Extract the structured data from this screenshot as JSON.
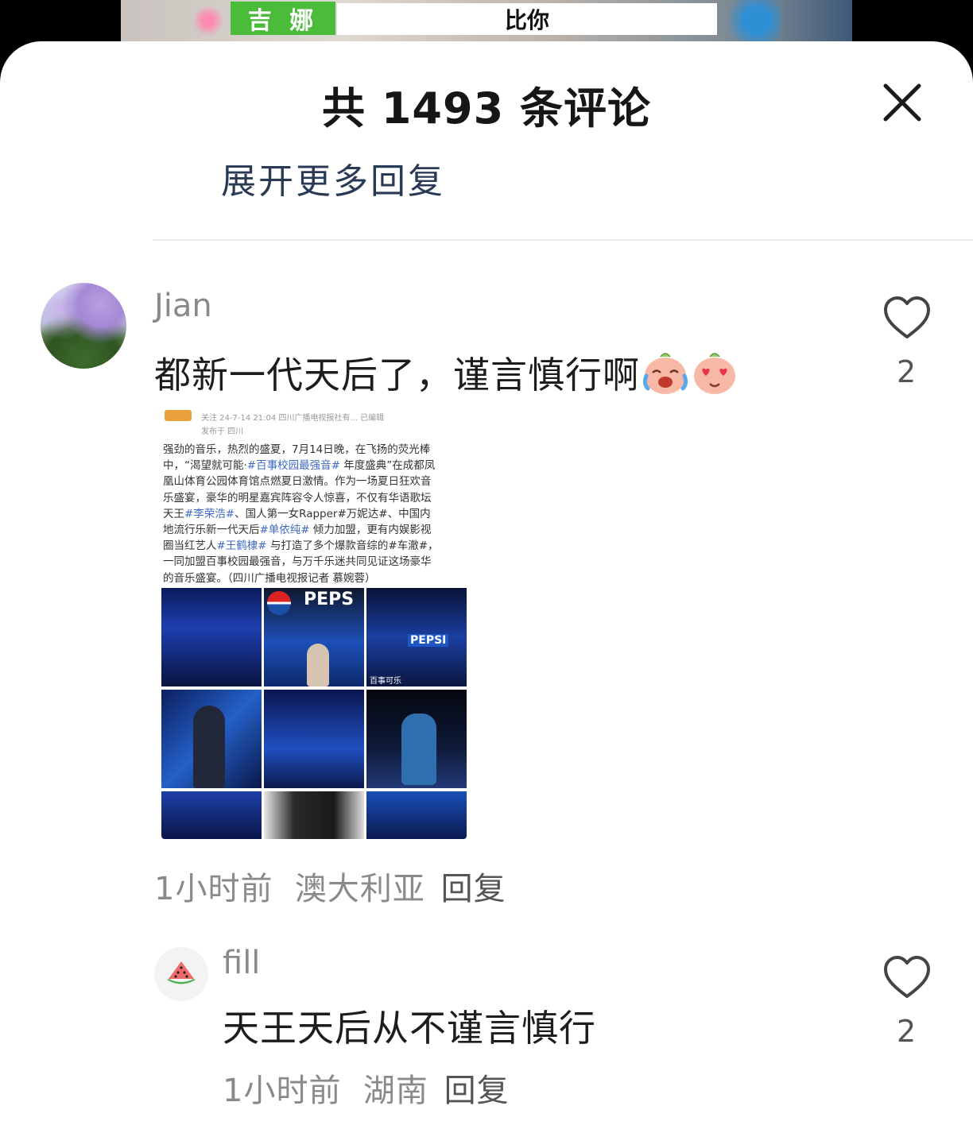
{
  "video": {
    "name_tag": "吉 娜",
    "lyric": "比你"
  },
  "panel": {
    "title": "共 1493 条评论",
    "expand_more": "展开更多回复"
  },
  "comment": {
    "username": "Jian",
    "text": "都新一代天后了，谨言慎行啊",
    "like_count": "2",
    "time": "1小时前",
    "location": "澳大利亚",
    "reply_label": "回复",
    "emoji_1": "crying-laughing-sticker",
    "emoji_2": "heart-eyes-sticker",
    "image": {
      "header_meta": "关注  24-7-14 21:04  四川广播电视报社有...  已编辑",
      "header_loc": "发布于 四川",
      "article": [
        {
          "pre": "强劲的音乐，热烈的盛夏，7月14日晚，在飞扬的荧光棒",
          "tag": "",
          "post": ""
        },
        {
          "pre": "中，“渴望就可能·",
          "tag": "#百事校园最强音#",
          "post": " 年度盛典”在成都凤"
        },
        {
          "pre": "凰山体育公园体育馆点燃夏日激情。作为一场夏日狂欢音",
          "tag": "",
          "post": ""
        },
        {
          "pre": "乐盛宴，豪华的明星嘉宾阵容令人惊喜，不仅有华语歌坛",
          "tag": "",
          "post": ""
        },
        {
          "pre": "天王",
          "tag": "#李荣浩#",
          "post": "、国人第一女Rapper#万妮达#、中国内"
        },
        {
          "pre": "地流行乐新一代天后",
          "tag": "#单依纯#",
          "post": " 倾力加盟，更有内娱影视"
        },
        {
          "pre": "圈当红艺人",
          "tag": "#王鹤棣#",
          "post": " 与打造了多个爆款音综的#车澈#，"
        },
        {
          "pre": "一同加盟百事校园最强音，与万千乐迷共同见证这场豪华",
          "tag": "",
          "post": ""
        },
        {
          "pre": "的音乐盛宴。（四川广播电视报记者 慕婉蓉）",
          "tag": "",
          "post": ""
        }
      ],
      "tile_texts": [
        "PEPS",
        "PEPSI",
        "百事可乐"
      ]
    }
  },
  "reply": {
    "username": "fill",
    "text": "天王天后从不谨言慎行",
    "like_count": "2",
    "time": "1小时前",
    "location": "湖南",
    "reply_label": "回复",
    "avatar_icon": "watermelon-icon"
  },
  "colors": {
    "sheet_bg": "#ffffff",
    "link_text": "#2a3a55",
    "meta_text": "#8a8a8a",
    "name_tag_green": "#4bbb3a"
  }
}
